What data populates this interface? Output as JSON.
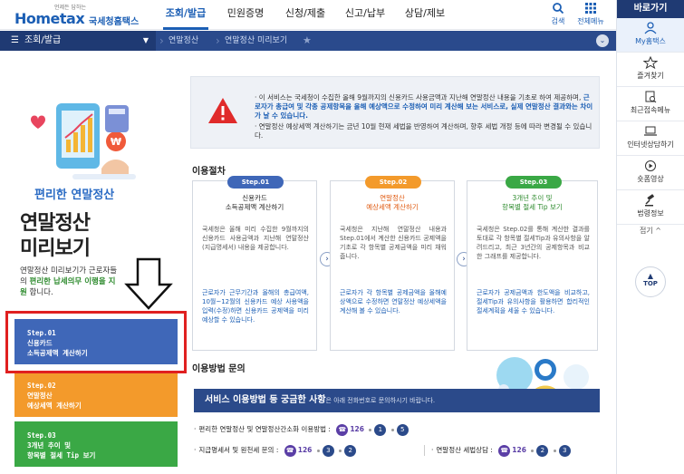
{
  "header": {
    "slogan": "언제든 답하는",
    "brand": "Hometax",
    "brand_ko": "국세청홈택스",
    "nav": [
      "조회/발급",
      "민원증명",
      "신청/제출",
      "신고/납부",
      "상담/제보"
    ],
    "active_nav": "조회/발급",
    "search_label": "검색",
    "allmenu_label": "전체메뉴"
  },
  "subnav": {
    "menu_label": "조회/발급",
    "crumbs": [
      "연말정산",
      "연말정산 미리보기"
    ]
  },
  "quick": {
    "title": "바로가기",
    "items": [
      "My홈택스",
      "즐겨찾기",
      "최근접속메뉴",
      "인터넷상담하기",
      "숏폼영상",
      "법령정보"
    ],
    "fold_label": "접기 ^",
    "top_label": "TOP"
  },
  "left": {
    "tagline": "편리한 연말정산",
    "title_line1": "연말정산",
    "title_line2": "미리보기",
    "desc_pre": "연말정산 미리보기가 근로자들의",
    "desc_hl": "편리한 납세의무 이행을 지원",
    "desc_post": "합니다.",
    "buttons": [
      {
        "step": "Step.01",
        "label": "신용카드",
        "label2": "소득공제액 계산하기",
        "color": "#3f67b8"
      },
      {
        "step": "Step.02",
        "label": "연말정산",
        "label2": "예상세액 계산하기",
        "color": "#f39a2b"
      },
      {
        "step": "Step.03",
        "label": "3개년 추이 및",
        "label2": "항목별 절세 Tip 보기",
        "color": "#3aa845"
      }
    ]
  },
  "notice": {
    "line1_pre": "이 서비스는 국세청이 수집한 올해 9월까지의 신용카드 사용금액과 지난해 연말정산 내용을 기초로 하여 제공하며,",
    "line1_hl": "근로자가 총급여 및 각종 공제항목을 올해 예상액으로 수정하여 미리 계산해 보는 서비스로, 실제 연말정산 결과와는 차이가 날 수 있습니다.",
    "line2": "연말정산 예상세액 계산하기는 금년 10월 현재 세법을 반영하여 계산하며, 향후 세법 개정 등에 따라 변경될 수 있습니다."
  },
  "procedure": {
    "title": "이용절차",
    "steps": [
      {
        "pill": "Step.01",
        "pill_color": "#3f67b8",
        "title1": "신용카드",
        "title2": "소득공제액 계산하기",
        "title_color": "#222",
        "body": "국세청은 올해 미리 수집한 9월까지의 신용카드 사용금액과 지난해 연말정산(지급명세서) 내용을 제공합니다.",
        "note": "근로자가 근무기간과 올해의 총급여액, 10월~12월의 신용카드 예상 사용액을 입력(수정)하면 신용카드 공제액을 미리 예상할 수 있습니다."
      },
      {
        "pill": "Step.02",
        "pill_color": "#f39a2b",
        "title1": "연말정산",
        "title2": "예상세액 계산하기",
        "title_color": "#e05a10",
        "body": "국세청은 지난해 연말정산 내용과 Step.01에서 계산한 신용카드 공제액을 기초로 각 항목별 공제금액을 미리 채워줍니다.",
        "note": "근로자가 각 항목별 공제금액을 올해예상액으로 수정하면 연말정산 예상세액을 계산해 볼 수 있습니다."
      },
      {
        "pill": "Step.03",
        "pill_color": "#3aa845",
        "title1": "3개년 추이 및",
        "title2": "항목별 절세 Tip 보기",
        "title_color": "#2e8b2e",
        "body": "국세청은 Step.02를 통해 계산한 결과를 토대로 각 항목별 절세Tip과 유의사항을 알려드리고, 최근 3년간의 공제항목과 비교한 그래프를 제공합니다.",
        "note": "근로자가 공제금액과 한도액을 비교하고, 절세Tip과 유의사항을 활용하면 합리적인 절세계획을 세울 수 있습니다."
      }
    ]
  },
  "inquiry": {
    "title": "이용방법 문의",
    "banner_bold": "서비스 이용방법 등 궁금한 사항",
    "banner_rest": "은 아래 전화번호로 문의하시기 바랍니다.",
    "rows": [
      {
        "label": "편리한 연말정산 및 연말정산간소화 이용방법 :",
        "number": "126",
        "seq": [
          "1",
          "5"
        ]
      },
      {
        "label": "지급명세서 및 원천세 문의 :",
        "number": "126",
        "seq": [
          "3",
          "2"
        ]
      },
      {
        "label": "연말정산 세법상담 :",
        "number": "126",
        "seq": [
          "2",
          "3"
        ]
      }
    ]
  }
}
